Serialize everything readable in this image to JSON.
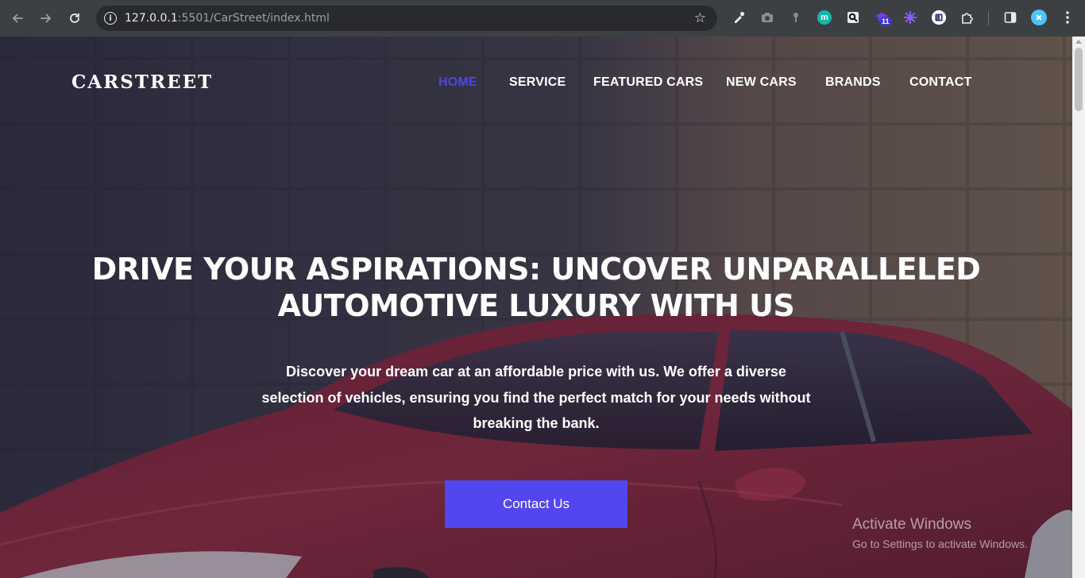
{
  "browser": {
    "url_host": "127.0.0.1",
    "url_rest": ":5501/CarStreet/index.html",
    "extensions": [
      {
        "icon": "eyedropper-icon"
      },
      {
        "icon": "camera-icon"
      },
      {
        "icon": "pin-icon"
      },
      {
        "icon": "m-extension-icon",
        "label": "m"
      },
      {
        "icon": "search-extension-icon"
      },
      {
        "icon": "graduation-cap-icon",
        "badge": "11"
      },
      {
        "icon": "gear-flower-icon"
      },
      {
        "icon": "app-extension-icon"
      },
      {
        "icon": "puzzle-icon"
      }
    ]
  },
  "site": {
    "logo": "CARSTREET",
    "nav": [
      "HOME",
      "SERVICE",
      "FEATURED CARS",
      "NEW CARS",
      "BRANDS",
      "CONTACT"
    ],
    "active_nav": "HOME",
    "headline_line1": "DRIVE YOUR ASPIRATIONS: UNCOVER UNPARALLELED",
    "headline_line2": "AUTOMOTIVE LUXURY WITH US",
    "sub_line1": "Discover your dream car at an affordable price with us. We offer a diverse",
    "sub_line2": "selection of vehicles, ensuring you find the perfect match for your needs without",
    "sub_line3": "breaking the bank.",
    "cta": "Contact Us"
  },
  "watermark": {
    "title": "Activate Windows",
    "subtitle": "Go to Settings to activate Windows."
  },
  "colors": {
    "accent": "#5146f0",
    "active_nav": "#4f46e5",
    "chrome_bg": "#3c4043",
    "car_red": "#8a2a3c"
  }
}
